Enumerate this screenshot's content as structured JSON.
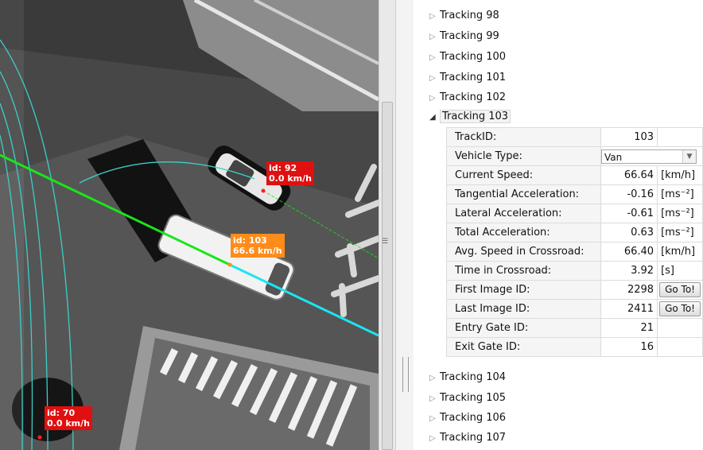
{
  "video": {
    "labels": [
      {
        "id_text": "id: 92",
        "speed_text": "0.0 km/h",
        "color": "#e01010"
      },
      {
        "id_text": "id: 103",
        "speed_text": "66.6 km/h",
        "color": "#ff8c1a"
      },
      {
        "id_text": "id: 70",
        "speed_text": "0.0 km/h",
        "color": "#e01010"
      }
    ],
    "colors": {
      "trajectory_green": "#19e619",
      "trajectory_cyan": "#19e6f0",
      "arc": "#3ccfc8"
    }
  },
  "tree": {
    "collapsed_before": [
      "Tracking 98",
      "Tracking 99",
      "Tracking 100",
      "Tracking 101",
      "Tracking 102"
    ],
    "expanded": {
      "label": "Tracking 103",
      "properties": [
        {
          "name": "TrackID:",
          "value": "103",
          "unit": ""
        },
        {
          "name": "Vehicle Type:",
          "value": "Van",
          "unit": ""
        },
        {
          "name": "Current Speed:",
          "value": "66.64",
          "unit": "[km/h]"
        },
        {
          "name": "Tangential Acceleration:",
          "value": "-0.16",
          "unit": "[ms⁻²]"
        },
        {
          "name": "Lateral Acceleration:",
          "value": "-0.61",
          "unit": "[ms⁻²]"
        },
        {
          "name": "Total Acceleration:",
          "value": "0.63",
          "unit": "[ms⁻²]"
        },
        {
          "name": "Avg. Speed in Crossroad:",
          "value": "66.40",
          "unit": "[km/h]"
        },
        {
          "name": "Time in Crossroad:",
          "value": "3.92",
          "unit": "[s]"
        },
        {
          "name": "First Image ID:",
          "value": "2298",
          "unit": "Go To!"
        },
        {
          "name": "Last Image ID:",
          "value": "2411",
          "unit": "Go To!"
        },
        {
          "name": "Entry Gate ID:",
          "value": "21",
          "unit": ""
        },
        {
          "name": "Exit Gate ID:",
          "value": "16",
          "unit": ""
        }
      ]
    },
    "collapsed_after": [
      "Tracking 104",
      "Tracking 105",
      "Tracking 106",
      "Tracking 107"
    ]
  },
  "icons": {
    "collapsed": "triangle-right-icon",
    "expanded": "triangle-down-icon",
    "dropdown": "chevron-down-icon"
  }
}
